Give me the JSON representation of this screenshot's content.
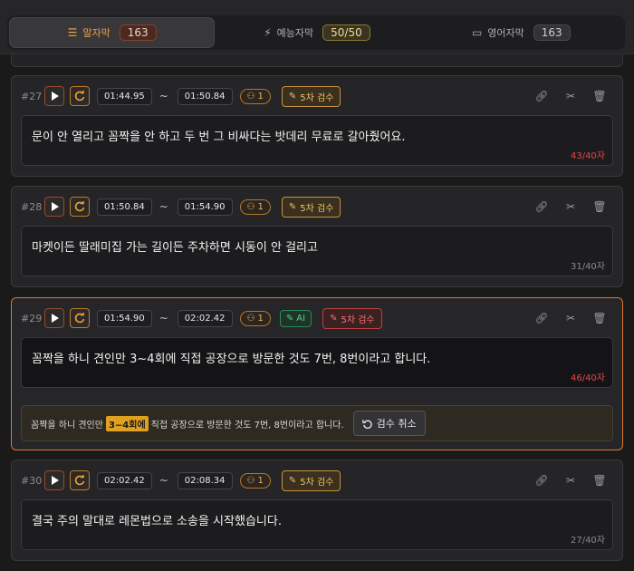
{
  "tabs": [
    {
      "label": "말자막",
      "count": "163",
      "icon": "list-check-icon"
    },
    {
      "label": "예능자막",
      "count": "50/50",
      "icon": "bolt-icon"
    },
    {
      "label": "영어자막",
      "count": "163",
      "icon": "caption-icon"
    }
  ],
  "cards": [
    {
      "seq": "#27",
      "start": "01:44.95",
      "end": "01:50.84",
      "speaker": "1",
      "review": "5차 검수",
      "text": "문이 안 열리고 꼼짝을 안 하고 두 번 그 비싸다는 밧데리 무료로 갈아줬어요.",
      "count": "43/40자"
    },
    {
      "seq": "#28",
      "start": "01:50.84",
      "end": "01:54.90",
      "speaker": "1",
      "review": "5차 검수",
      "text": "마켓이든 딸래미집 가는 길이든 주차하면 시동이 안 걸리고",
      "count": "31/40자"
    },
    {
      "seq": "#29",
      "start": "01:54.90",
      "end": "02:02.42",
      "speaker": "1",
      "ai": "AI",
      "review": "5차 검수",
      "text": "꼼짝을 하니 견인만 3~4회에 직접 공장으로 방문한 것도 7번, 8번이라고 합니다.",
      "count": "46/40자",
      "suggestion": {
        "before": "꼼짝을 하니 견인만",
        "highlight": "3~4회에",
        "after": "직접 공장으로 방문한 것도 7번, 8번이라고 합니다.",
        "cancel": "검수 취소"
      }
    },
    {
      "seq": "#30",
      "start": "02:02.42",
      "end": "02:08.34",
      "speaker": "1",
      "review": "5차 검수",
      "text": "결국 주의 말대로 레몬법으로 소송을 시작했습니다.",
      "count": "27/40자"
    }
  ],
  "tilde": "~",
  "colors": {
    "accent": "#e0762e",
    "warning_count": "#e04848",
    "review_chip": "#f0c060",
    "ai_chip": "#50d090"
  }
}
